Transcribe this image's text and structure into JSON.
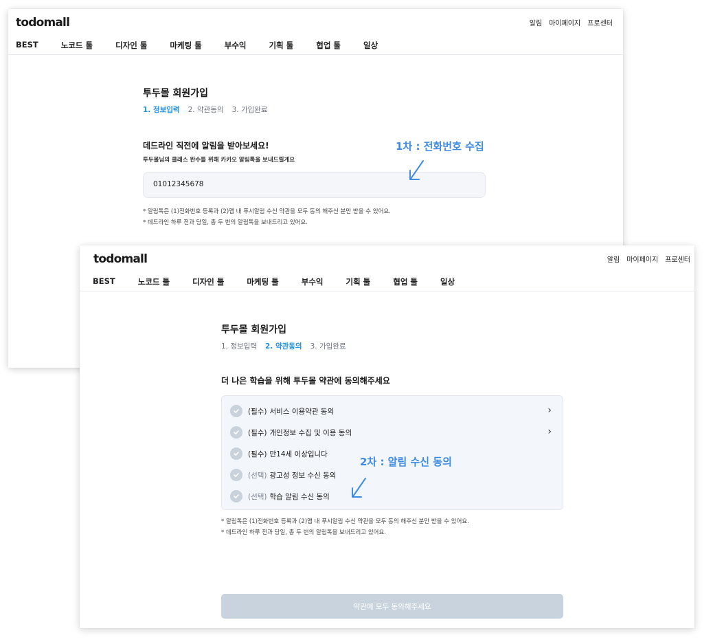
{
  "brand": "todomall",
  "util_links": [
    "알림",
    "마이페이지",
    "프로센터"
  ],
  "nav": [
    "BEST",
    "노코드 툴",
    "디자인 툴",
    "마케팅 툴",
    "부수익",
    "기획 툴",
    "협업 툴",
    "일상"
  ],
  "page_title": "투두몰 회원가입",
  "steps": [
    "1. 정보입력",
    "2. 약관동의",
    "3. 가입완료"
  ],
  "screen1": {
    "active_step": 0,
    "heading": "데드라인 직전에 알림을 받아보세요!",
    "subheading": "투두몰님의 클래스 완수를 위해 카카오 알림톡을 보내드릴게요",
    "phone_value": "01012345678",
    "notes": [
      "* 알림톡은 (1)전화번호 등록과 (2)앱 내 푸시알림 수신 약관을 모두 동의 해주신 분만 받을 수 있어요.",
      "* 데드라인 하루 전과 당일, 총 두 번의 알림톡을 보내드리고 있어요."
    ],
    "annotation": "1차 : 전화번호 수집"
  },
  "screen2": {
    "active_step": 1,
    "heading": "더 나은 학습을 위해 투두몰 약관에 동의해주세요",
    "agreements": [
      {
        "tag": "(필수)",
        "label": "서비스 이용약관 동의",
        "required": true,
        "has_arrow": true
      },
      {
        "tag": "(필수)",
        "label": "개인정보 수집 및 이용 동의",
        "required": true,
        "has_arrow": true
      },
      {
        "tag": "(필수)",
        "label": "만14세 이상입니다",
        "required": true,
        "has_arrow": false
      },
      {
        "tag": "(선택)",
        "label": "광고성 정보 수신 동의",
        "required": false,
        "has_arrow": false
      },
      {
        "tag": "(선택)",
        "label": "학습 알림 수신 동의",
        "required": false,
        "has_arrow": false
      }
    ],
    "chevron": "›",
    "notes": [
      "* 알림톡은 (1)전화번호 등록과 (2)앱 내 푸시알림 수신 약관을 모두 동의 해주신 분만 받을 수 있어요.",
      "* 데드라인 하루 전과 당일, 총 두 번의 알림톡을 보내드리고 있어요."
    ],
    "annotation": "2차 : 알림 수신 동의",
    "submit_label": "약관에 모두 동의해주세요"
  },
  "colors": {
    "accent": "#1e8fe1",
    "annotation": "#3d8be3",
    "disabled_button": "#c9d3de",
    "check_inactive": "#c9d1db"
  },
  "icons": [
    "check-icon",
    "chevron-right-icon",
    "annotation-arrow-icon"
  ]
}
